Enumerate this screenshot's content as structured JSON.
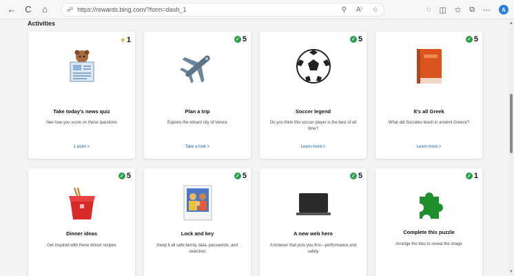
{
  "browser": {
    "url": "https://rewards.bing.com/?form=dash_1",
    "nav": {
      "back": "←",
      "refresh": "C",
      "home": "⌂"
    },
    "profile_letter": "A"
  },
  "section": {
    "title": "Activities"
  },
  "cards": [
    {
      "title": "Take today's news quiz",
      "desc": "See how you score on these questions",
      "link": "1 point >",
      "badge_value": "1",
      "badge_type": "plus"
    },
    {
      "title": "Plan a trip",
      "desc": "Explore the vibrant city of Venice",
      "link": "Take a look >",
      "badge_value": "5",
      "badge_type": "check"
    },
    {
      "title": "Soccer legend",
      "desc": "Do you think this soccer player is the best of all time?",
      "link": "Learn more >",
      "badge_value": "5",
      "badge_type": "check"
    },
    {
      "title": "It's all Greek",
      "desc": "What did Socrates teach in ancient Greece?",
      "link": "Learn more >",
      "badge_value": "5",
      "badge_type": "check"
    },
    {
      "title": "Dinner ideas",
      "desc": "Get inspired with these dinner recipes",
      "link": "",
      "badge_value": "5",
      "badge_type": "check"
    },
    {
      "title": "Lock and key",
      "desc": "Keep it all safe-family, data, passwords, and searches",
      "link": "",
      "badge_value": "5",
      "badge_type": "check"
    },
    {
      "title": "A new web hero",
      "desc": "A browser that puts you first—performance and safety",
      "link": "",
      "badge_value": "5",
      "badge_type": "check"
    },
    {
      "title": "Complete this puzzle",
      "desc": "Arrange the tiles to reveal the image",
      "link": "",
      "badge_value": "1",
      "badge_type": "check"
    }
  ],
  "colors": {
    "check_green": "#2e9e4f",
    "link_blue": "#1a5fb4",
    "plus_gold": "#e0a500"
  }
}
